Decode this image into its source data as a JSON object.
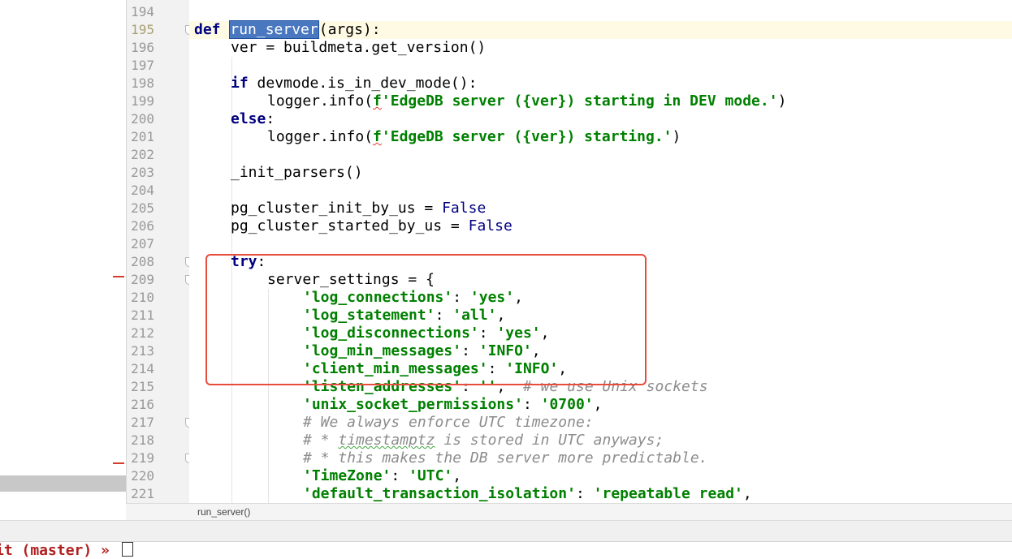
{
  "editor": {
    "line_numbers": [
      "194",
      "195",
      "196",
      "197",
      "198",
      "199",
      "200",
      "201",
      "202",
      "203",
      "204",
      "205",
      "206",
      "207",
      "208",
      "209",
      "210",
      "211",
      "212",
      "213",
      "214",
      "215",
      "216",
      "217",
      "218",
      "219",
      "220",
      "221"
    ],
    "current_line": "195",
    "lines": {
      "l195": {
        "kw": "def",
        "selected": "run_server",
        "rest": "(args):"
      },
      "l196": "ver = buildmeta.get_version()",
      "l198": {
        "kw": "if",
        "rest": " devmode.is_in_dev_mode():"
      },
      "l199": {
        "pre": "logger.info(",
        "fprefix": "f",
        "str": "'EdgeDB server ({ver}) starting in DEV mode.'",
        "post": ")"
      },
      "l200": {
        "kw": "else",
        "rest": ":"
      },
      "l201": {
        "pre": "logger.info(",
        "fprefix": "f",
        "str": "'EdgeDB server ({ver}) starting.'",
        "post": ")"
      },
      "l203": "_init_parsers()",
      "l205": {
        "pre": "pg_cluster_init_by_us = ",
        "const": "False"
      },
      "l206": {
        "pre": "pg_cluster_started_by_us = ",
        "const": "False"
      },
      "l208": {
        "kw": "try",
        "rest": ":"
      },
      "l209": "server_settings = {",
      "l210": {
        "key": "'log_connections'",
        "sep": ": ",
        "val": "'yes'",
        "end": ","
      },
      "l211": {
        "key": "'log_statement'",
        "sep": ": ",
        "val": "'all'",
        "end": ","
      },
      "l212": {
        "key": "'log_disconnections'",
        "sep": ": ",
        "val": "'yes'",
        "end": ","
      },
      "l213": {
        "key": "'log_min_messages'",
        "sep": ": ",
        "val": "'INFO'",
        "end": ","
      },
      "l214": {
        "key": "'client_min_messages'",
        "sep": ": ",
        "val": "'INFO'",
        "end": ","
      },
      "l215": {
        "key": "'listen_addresses'",
        "sep": ": ",
        "val": "''",
        "end": ",  ",
        "comment": "# we use Unix sockets"
      },
      "l216": {
        "key": "'unix_socket_permissions'",
        "sep": ": ",
        "val": "'0700'",
        "end": ","
      },
      "l217": "# We always enforce UTC timezone:",
      "l218": {
        "pre": "# * ",
        "squiggle": "timestamptz",
        "post": " is stored in UTC anyways;"
      },
      "l219": "# * this makes the DB server more predictable.",
      "l220": {
        "key": "'TimeZone'",
        "sep": ": ",
        "val": "'UTC'",
        "end": ","
      },
      "l221": {
        "key": "'default_transaction_isolation'",
        "sep": ": ",
        "val": "'repeatable read'",
        "end": ","
      }
    }
  },
  "breadcrumb": "run_server()",
  "terminal": {
    "prompt": "it (master) »"
  },
  "colors": {
    "keyword": "#000080",
    "string": "#008000",
    "comment": "#8c8c8c",
    "selection": "#4a78c0",
    "annotation": "#e74c3c"
  }
}
